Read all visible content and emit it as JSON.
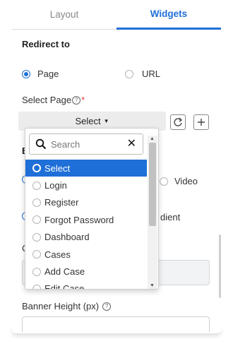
{
  "tabs": [
    {
      "label": "Layout"
    },
    {
      "label": "Widgets"
    }
  ],
  "redirect": {
    "title": "Redirect to",
    "options": [
      "Page",
      "URL"
    ],
    "selected": "Page"
  },
  "select_page": {
    "label": "Select Page",
    "required_mark": "*",
    "value": "Select"
  },
  "dropdown": {
    "search_placeholder": "Search",
    "options": [
      "Select",
      "Login",
      "Register",
      "Forgot Password",
      "Dashboard",
      "Cases",
      "Add Case",
      "Edit Case"
    ],
    "selected": "Select"
  },
  "partially_hidden": {
    "b_label": "B",
    "video_option": "Video",
    "c_label": "C",
    "gradient_option": "dient"
  },
  "banner": {
    "label": "Banner Height (px)"
  },
  "colors": {
    "accent": "#1f6fd8",
    "required": "#e53935"
  }
}
